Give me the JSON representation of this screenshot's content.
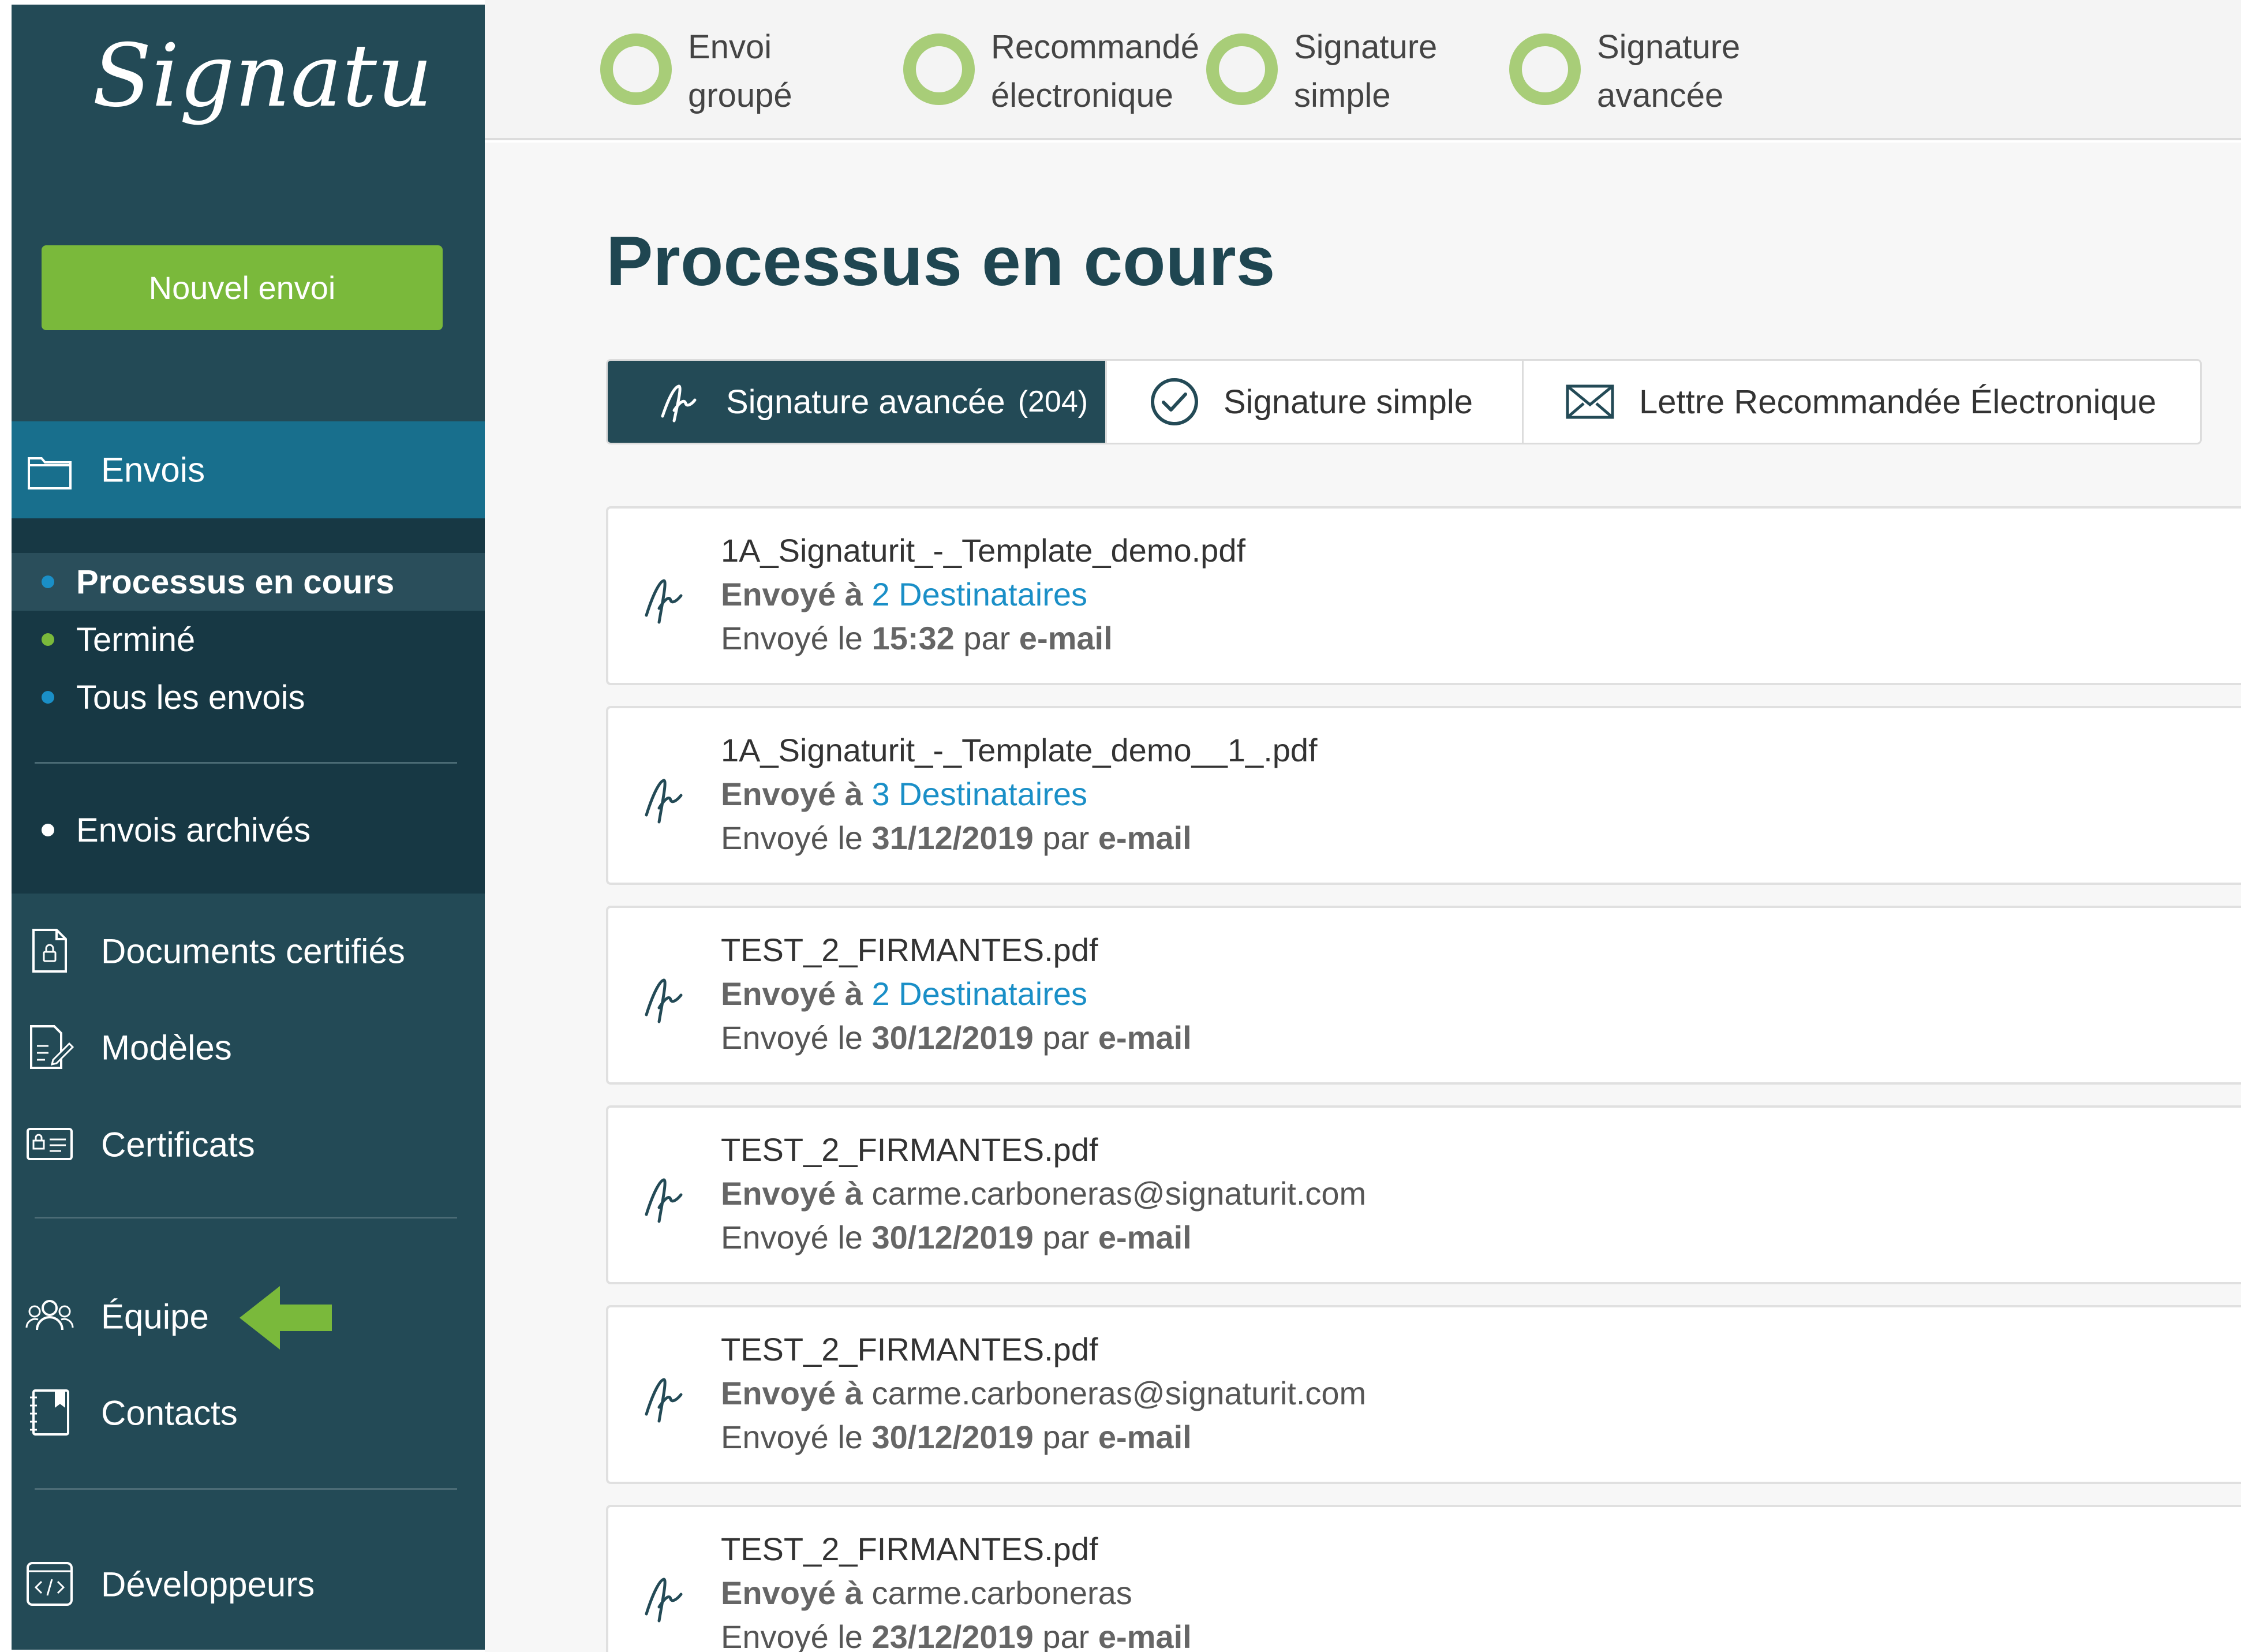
{
  "app": {
    "logo_text": "Signaturit",
    "new_button": "Nouvel envoi"
  },
  "sidebar": {
    "envois_label": "Envois",
    "submenu": [
      {
        "label": "Processus en cours",
        "dot_color": "#1a8fc7"
      },
      {
        "label": "Terminé",
        "dot_color": "#7ab93b"
      },
      {
        "label": "Tous les envois",
        "dot_color": "#1a8fc7"
      },
      {
        "label": "Envois archivés",
        "dot_color": "#ffffff"
      }
    ],
    "nav": [
      {
        "label": "Documents certifiés",
        "icon": "certified-document-icon"
      },
      {
        "label": "Modèles",
        "icon": "template-icon"
      },
      {
        "label": "Certificats",
        "icon": "certificate-card-icon"
      },
      {
        "label": "Équipe",
        "icon": "team-icon"
      },
      {
        "label": "Contacts",
        "icon": "contacts-book-icon"
      },
      {
        "label": "Développeurs",
        "icon": "code-icon"
      }
    ]
  },
  "topbar": {
    "steps": [
      {
        "line1": "Envoi",
        "line2": "groupé"
      },
      {
        "line1": "Recommandé",
        "line2": "électronique"
      },
      {
        "line1": "Signature",
        "line2": "simple"
      },
      {
        "line1": "Signature",
        "line2": "avancée"
      }
    ]
  },
  "main": {
    "title": "Processus en cours",
    "tabs": [
      {
        "label": "Signature avancée",
        "count": "(204)",
        "icon": "signature-icon"
      },
      {
        "label": "Signature simple",
        "count": "",
        "icon": "check-circle-icon"
      },
      {
        "label": "Lettre Recommandée Électronique",
        "count": "",
        "icon": "envelope-icon"
      }
    ],
    "envoye_a": "Envoyé à",
    "envoye_le": "Envoyé le",
    "par": "par",
    "channel": "e-mail",
    "items": [
      {
        "file": "1A_Signaturit_-_Template_demo.pdf",
        "recipients": "2 Destinataires",
        "is_link": true,
        "date": "15:32"
      },
      {
        "file": "1A_Signaturit_-_Template_demo__1_.pdf",
        "recipients": "3 Destinataires",
        "is_link": true,
        "date": "31/12/2019"
      },
      {
        "file": "TEST_2_FIRMANTES.pdf",
        "recipients": "2 Destinataires",
        "is_link": true,
        "date": "30/12/2019"
      },
      {
        "file": "TEST_2_FIRMANTES.pdf",
        "recipients": "carme.carboneras@signaturit.com",
        "is_link": false,
        "date": "30/12/2019"
      },
      {
        "file": "TEST_2_FIRMANTES.pdf",
        "recipients": "carme.carboneras@signaturit.com",
        "is_link": false,
        "date": "30/12/2019"
      },
      {
        "file": "TEST_2_FIRMANTES.pdf",
        "recipients": "carme.carboneras",
        "is_link": false,
        "date": "23/12/2019"
      }
    ]
  },
  "colors": {
    "sidebar": "#234a56",
    "accent_green": "#7ab93b",
    "active_blue": "#186f8d",
    "link_blue": "#1a8fc7"
  }
}
